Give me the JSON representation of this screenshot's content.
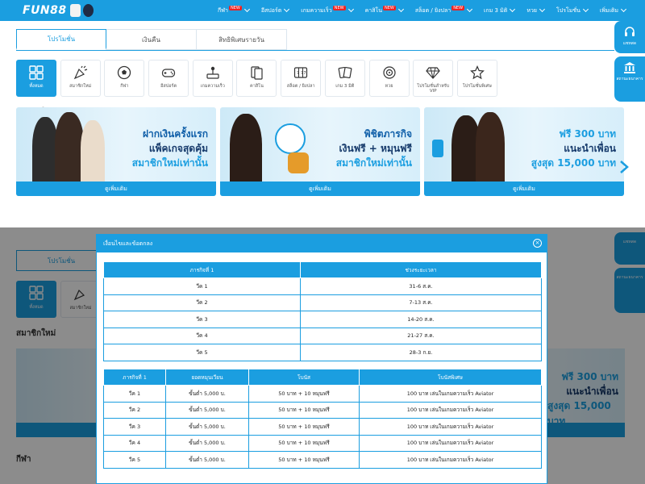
{
  "brand": {
    "logo": "FUN88"
  },
  "nav": [
    {
      "label": "กีฬา",
      "badge": "NEW"
    },
    {
      "label": "อีสปอร์ต",
      "badge": ""
    },
    {
      "label": "เกมความเร็ว",
      "badge": "NEW"
    },
    {
      "label": "คาสิโน",
      "badge": "NEW"
    },
    {
      "label": "สล็อต / ยิงปลา",
      "badge": "NEW"
    },
    {
      "label": "เกม 3 มิติ",
      "badge": ""
    },
    {
      "label": "หวย",
      "badge": ""
    },
    {
      "label": "โปรโมชั่น",
      "badge": ""
    },
    {
      "label": "เพิ่มเติม",
      "badge": ""
    }
  ],
  "tabs": [
    "โปรโมชั่น",
    "เงินคืน",
    "สิทธิพิเศษรายวัน"
  ],
  "categories": [
    {
      "label": "ทั้งหมด",
      "icon": "grid-icon"
    },
    {
      "label": "สมาชิกใหม่",
      "icon": "party-popper-icon"
    },
    {
      "label": "กีฬา",
      "icon": "soccer-ball-icon"
    },
    {
      "label": "อีสปอร์ต",
      "icon": "gamepad-icon"
    },
    {
      "label": "เกมความเร็ว",
      "icon": "joystick-icon"
    },
    {
      "label": "คาสิโน",
      "icon": "cards-icon"
    },
    {
      "label": "สล็อต / ยิงปลา",
      "icon": "slot-machine-icon"
    },
    {
      "label": "เกม 3 มิติ",
      "icon": "3d-cards-icon"
    },
    {
      "label": "หวย",
      "icon": "lottery-icon"
    },
    {
      "label": "โปรโมชั่นสำหรับ VIP",
      "icon": "diamond-icon"
    },
    {
      "label": "โปรโมชั่นพิเศษ",
      "icon": "star-icon"
    }
  ],
  "section_title": "สมาชิกใหม่",
  "section_title_2": "กีฬา",
  "banners": [
    {
      "line1": "ฝากเงินครั้งแรก",
      "line2": "แพ็คเกจสุดคุ้ม",
      "line3": "สมาชิกใหม่เท่านั้น",
      "button": "ดูเพิ่มเติม"
    },
    {
      "line1": "พิชิตภารกิจ",
      "line2": "เงินฟรี + หมุนฟรี",
      "line3": "สมาชิกใหม่เท่านั้น",
      "button": "ดูเพิ่มเติม"
    },
    {
      "line1": "ฟรี 300 บาท",
      "line2": "แนะนำเพื่อน",
      "line3": "สูงสุด 15,000 บาท",
      "button": "ดูเพิ่มเติม"
    }
  ],
  "side": {
    "support": "แชทสด",
    "bank": "สถานะธนาคาร"
  },
  "modal": {
    "title": "เงื่อนไขและข้อตกลง",
    "close": "×",
    "table1": {
      "headers": [
        "ภารกิจที่ 1",
        "ช่วงระยะเวลา"
      ],
      "rows": [
        [
          "วีค 1",
          "31-6 ส.ค."
        ],
        [
          "วีค 2",
          "7-13 ส.ค."
        ],
        [
          "วีค 3",
          "14-20 ส.ค."
        ],
        [
          "วีค 4",
          "21-27 ส.ค."
        ],
        [
          "วีค 5",
          "28-3 ก.ย."
        ]
      ]
    },
    "table2": {
      "headers": [
        "ภารกิจที่ 1",
        "ยอดหมุนเวียน",
        "โบนัส",
        "โบนัสพิเศษ"
      ],
      "rows": [
        [
          "วีค 1",
          "ขั้นต่ำ 5,000 บ.",
          "50 บาท + 10 หมุนฟรี",
          "100 บาท เล่นในเกมความเร็ว Aviator"
        ],
        [
          "วีค 2",
          "ขั้นต่ำ 5,000 บ.",
          "50 บาท + 10 หมุนฟรี",
          "100 บาท เล่นในเกมความเร็ว Aviator"
        ],
        [
          "วีค 3",
          "ขั้นต่ำ 5,000 บ.",
          "50 บาท + 10 หมุนฟรี",
          "100 บาท เล่นในเกมความเร็ว Aviator"
        ],
        [
          "วีค 4",
          "ขั้นต่ำ 5,000 บ.",
          "50 บาท + 10 หมุนฟรี",
          "100 บาท เล่นในเกมความเร็ว Aviator"
        ],
        [
          "วีค 5",
          "ขั้นต่ำ 5,000 บ.",
          "50 บาท + 10 หมุนฟรี",
          "100 บาท เล่นในเกมความเร็ว Aviator"
        ]
      ]
    }
  },
  "colors": {
    "accent": "#1b9ee0",
    "badge": "#e22222"
  }
}
